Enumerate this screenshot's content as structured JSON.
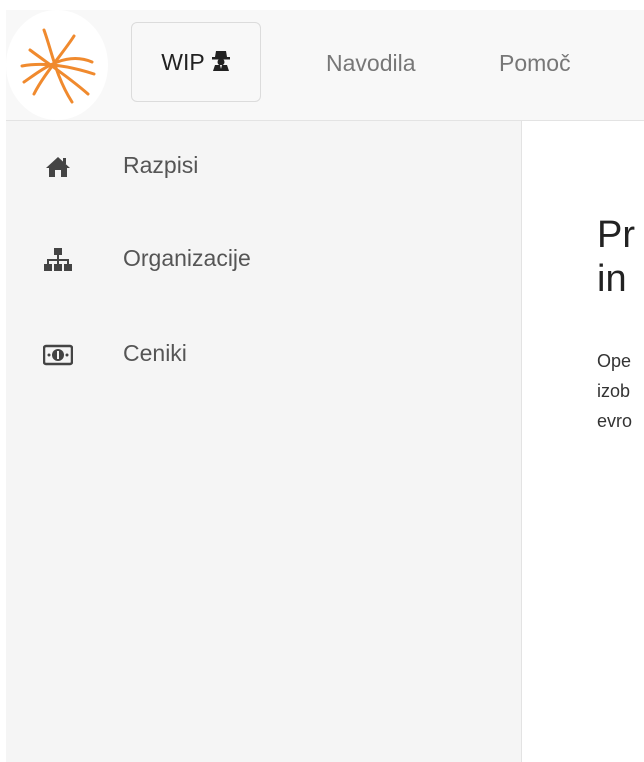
{
  "colors": {
    "accent": "#f08a2e",
    "navbar_bg": "#f8f8f8",
    "sidebar_bg": "#f5f5f5",
    "icon_color": "#444444"
  },
  "navbar": {
    "logo_icon": "star-orbit-logo",
    "wip_button": {
      "label": "WIP",
      "icon": "user-secret-icon"
    },
    "links": [
      "Navodila",
      "Pomoč"
    ]
  },
  "sidebar": {
    "items": [
      {
        "label": "Razpisi",
        "icon": "home-icon"
      },
      {
        "label": "Organizacije",
        "icon": "sitemap-icon"
      },
      {
        "label": "Ceniki",
        "icon": "money-icon"
      }
    ]
  },
  "main": {
    "title_lines": [
      "Pr",
      "in"
    ],
    "text_lines": [
      "Ope",
      "izob",
      "evro"
    ]
  }
}
